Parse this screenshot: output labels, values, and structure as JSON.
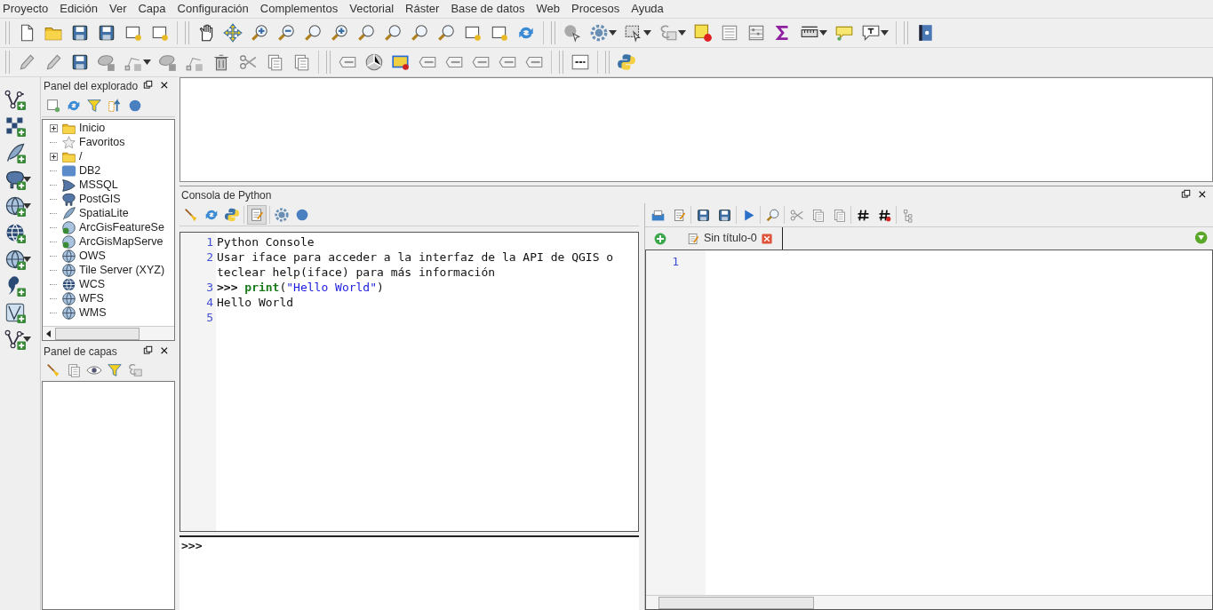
{
  "menu": [
    {
      "label": "Proyecto"
    },
    {
      "label": "Edición"
    },
    {
      "label": "Ver"
    },
    {
      "label": "Capa"
    },
    {
      "label": "Configuración"
    },
    {
      "label": "Complementos"
    },
    {
      "label": "Vectorial"
    },
    {
      "label": "Ráster"
    },
    {
      "label": "Base de datos"
    },
    {
      "label": "Web"
    },
    {
      "label": "Procesos"
    },
    {
      "label": "Ayuda"
    }
  ],
  "browser_panel": {
    "title": "Panel del explorado",
    "items": [
      {
        "label": "Inicio",
        "expandable": true
      },
      {
        "label": "Favoritos",
        "expandable": false
      },
      {
        "label": "/",
        "expandable": true
      },
      {
        "label": "DB2",
        "expandable": false
      },
      {
        "label": "MSSQL",
        "expandable": false
      },
      {
        "label": "PostGIS",
        "expandable": false
      },
      {
        "label": "SpatiaLite",
        "expandable": false
      },
      {
        "label": "ArcGisFeatureSe",
        "expandable": false
      },
      {
        "label": "ArcGisMapServe",
        "expandable": false
      },
      {
        "label": "OWS",
        "expandable": false
      },
      {
        "label": "Tile Server (XYZ)",
        "expandable": false
      },
      {
        "label": "WCS",
        "expandable": false
      },
      {
        "label": "WFS",
        "expandable": false
      },
      {
        "label": "WMS",
        "expandable": false
      }
    ]
  },
  "layers_panel": {
    "title": "Panel de capas"
  },
  "python_console": {
    "title": "Consola de Python",
    "lines": [
      {
        "number": "1",
        "segments": [
          {
            "kind": "plain",
            "text": "Python Console"
          }
        ]
      },
      {
        "number": "2",
        "segments": [
          {
            "kind": "plain",
            "text": "Usar iface para acceder a la interfaz de la API de QGIS o teclear help(iface) para más información"
          }
        ]
      },
      {
        "number": "3",
        "segments": [
          {
            "kind": "prompt",
            "text": ">>> "
          },
          {
            "kind": "keyword",
            "text": "print"
          },
          {
            "kind": "plain",
            "text": "("
          },
          {
            "kind": "string",
            "text": "\"Hello World\""
          },
          {
            "kind": "plain",
            "text": ")"
          }
        ]
      },
      {
        "number": "4",
        "segments": [
          {
            "kind": "plain",
            "text": "Hello World"
          }
        ]
      },
      {
        "number": "5"
      }
    ],
    "input_prompt": ">>>"
  },
  "editor": {
    "tabs": [
      {
        "label": "Sin título-0",
        "selected": true
      }
    ],
    "line_numbers": [
      "1"
    ]
  }
}
